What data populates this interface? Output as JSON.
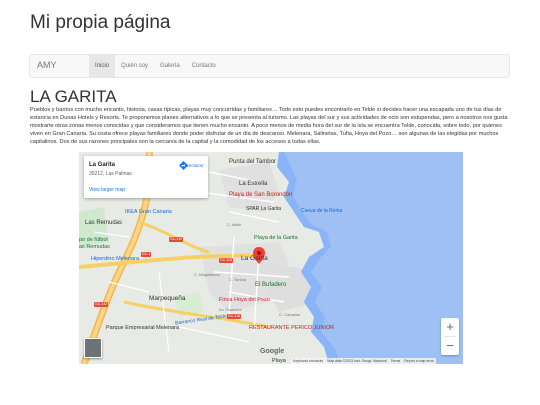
{
  "site": {
    "title": "Mi propia página"
  },
  "nav": {
    "brand": "AMY",
    "items": [
      {
        "label": "Inicio",
        "active": true
      },
      {
        "label": "Quién soy",
        "active": false
      },
      {
        "label": "Galería",
        "active": false
      },
      {
        "label": "Contacto",
        "active": false
      }
    ]
  },
  "page": {
    "heading": "LA GARITA",
    "intro": "Pueblos y barrios con mucho encanto, historia, casas típicas, playas muy concurridas y familiares… Todo esto puedes encontrarlo en Telde si decides hacer una escapada uno de tus días de estancia en Dunas Hotels y Resorts. Te proponemos planes alternativos a lo que se presenta al turismo. Las playas del sur y sus actividades de ocio son estupendas, pero a nosotros nos gusta mostrarte otras zonas menos conocidas y que consideramos que tienen mucho encanto. A poco menos de media hora del sur de la isla se encuentra Telde, conocida, sobre todo, por quienes viven en Gran Canaria. Su costa ofrece playas familiares donde poder disfrutar de un día de descanso. Melenara, Salinetas, Tufia, Hoya del Pozo… son algunas de las elegidas por muchos capitalinos. Dos de sus razones principales son la cercanía de la capital y la comodidad de los accesos a todas ellas."
  },
  "map": {
    "info_card": {
      "title": "La Garita",
      "address": "35212, Las Palmas",
      "directions_label": "Directions",
      "larger_map_link": "View larger map"
    },
    "labels": {
      "punta_del_tambor": "Punta del Tambor",
      "la_estrella": "La Estrella",
      "playa_san_borondon": "Playa de San Borondón",
      "spar": "SPAR La Garita",
      "cueva_de_la_reina": "Cueva de la Reina",
      "ikea": "IKEA Gran Canaria",
      "las_remudas_top": "Las Remudas",
      "las_remudas": "Las Remudas",
      "campo_futbol": "po de fútbol",
      "remudas_sub": "as Remudas",
      "hiperdino": "Hiperdino Melenara",
      "playa_garita": "Playa de la Garita",
      "la_garita": "La Garita",
      "el_bufadero": "El Bufadero",
      "marpequena": "Marpequeña",
      "finca_hoya": "Finca Hoya del Pozo",
      "parque_empresarial": "Parque Empresarial Melenara",
      "restaurante": "RESTAURANTE PERICO JUNIOR",
      "barranco_real": "Barranco Real de Telde",
      "playa_bottom": "Playa",
      "road_gc1": "GC-1",
      "road_gc100": "GC-100",
      "road_gc110": "GC-110",
      "road_gc118": "GC-118",
      "road_gc142": "GC-142",
      "street_altair": "C. Altair",
      "street_tortola": "C. Tortola",
      "street_magallanes": "C. Magallanes",
      "street_guanche": "Av. Guanche",
      "street_canarias": "C. Canarias"
    },
    "controls": {
      "zoom_in": "+",
      "zoom_out": "−"
    },
    "google": "Google",
    "attribution": {
      "shortcuts": "Keyboard shortcuts",
      "data": "Map data ©2023 Inst. Geogr. Nacional",
      "terms": "Terms",
      "report": "Report a map error"
    },
    "colors": {
      "water": "#8ab4f8",
      "land": "#e8eae6",
      "highway": "#f7c35f",
      "road": "#ffffff",
      "park": "#c8e6c9",
      "urban": "#dcdcdc"
    }
  }
}
